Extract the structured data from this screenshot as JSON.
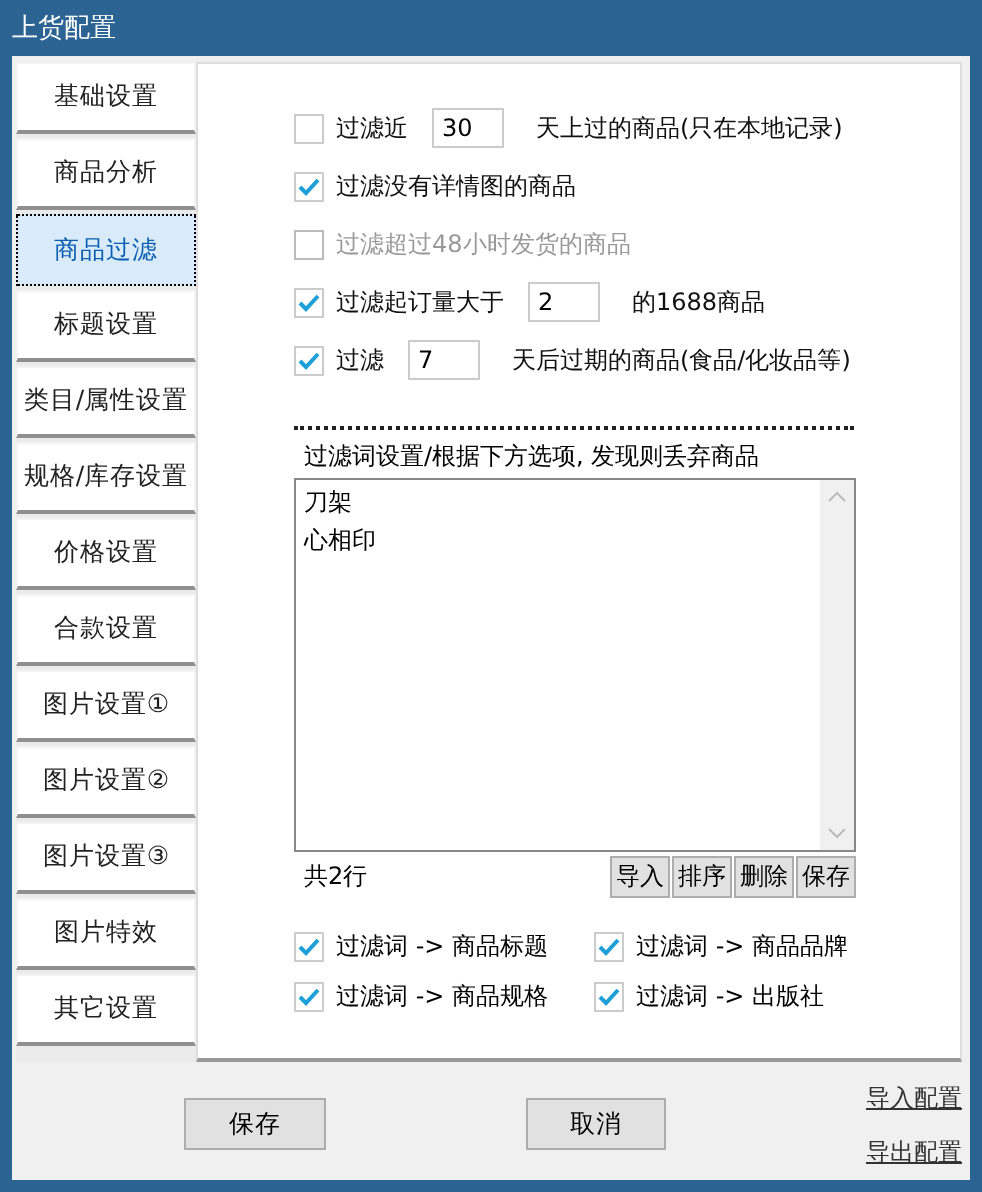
{
  "window": {
    "title": "上货配置"
  },
  "sidebar": {
    "items": [
      {
        "label": "基础设置",
        "selected": false
      },
      {
        "label": "商品分析",
        "selected": false
      },
      {
        "label": "商品过滤",
        "selected": true
      },
      {
        "label": "标题设置",
        "selected": false
      },
      {
        "label": "类目/属性设置",
        "selected": false
      },
      {
        "label": "规格/库存设置",
        "selected": false
      },
      {
        "label": "价格设置",
        "selected": false
      },
      {
        "label": "合款设置",
        "selected": false
      },
      {
        "label": "图片设置①",
        "selected": false
      },
      {
        "label": "图片设置②",
        "selected": false
      },
      {
        "label": "图片设置③",
        "selected": false
      },
      {
        "label": "图片特效",
        "selected": false
      },
      {
        "label": "其它设置",
        "selected": false
      }
    ]
  },
  "options": [
    {
      "kind": "input",
      "checked": false,
      "disabled": false,
      "label": "过滤近",
      "value": "30",
      "suffix": "天上过的商品(只在本地记录)"
    },
    {
      "kind": "plain",
      "checked": true,
      "disabled": false,
      "label": "过滤没有详情图的商品"
    },
    {
      "kind": "plain",
      "checked": false,
      "disabled": true,
      "label": "过滤超过48小时发货的商品"
    },
    {
      "kind": "input",
      "checked": true,
      "disabled": false,
      "label": "过滤起订量大于",
      "value": "2",
      "suffix": "的1688商品"
    },
    {
      "kind": "input",
      "checked": true,
      "disabled": false,
      "label": "过滤",
      "value": "7",
      "suffix": "天后过期的商品(食品/化妆品等)"
    }
  ],
  "filter_words": {
    "heading": "过滤词设置/根据下方选项, 发现则丢弃商品",
    "lines": [
      "刀架",
      "心相印"
    ],
    "count": "共2行",
    "buttons": [
      "导入",
      "排序",
      "删除",
      "保存"
    ]
  },
  "targets": [
    {
      "label": "过滤词 -> 商品标题",
      "checked": true
    },
    {
      "label": "过滤词 -> 商品品牌",
      "checked": true
    },
    {
      "label": "过滤词 -> 商品规格",
      "checked": true
    },
    {
      "label": "过滤词 -> 出版社",
      "checked": true
    }
  ],
  "footer": {
    "buttons": [
      "保存",
      "取消"
    ],
    "links": [
      "导入配置",
      "导出配置"
    ]
  }
}
